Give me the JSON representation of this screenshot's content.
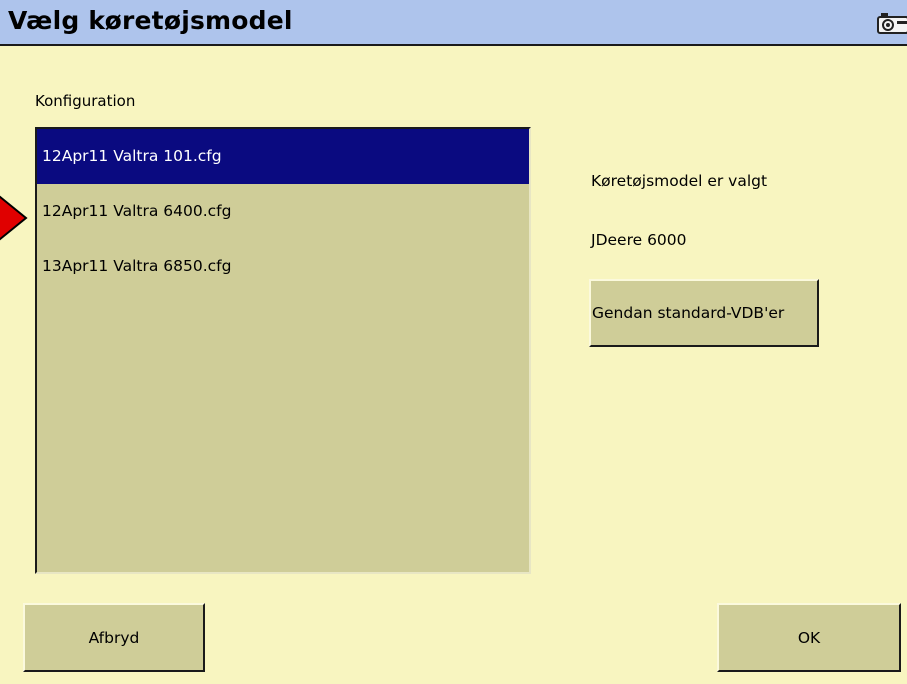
{
  "window": {
    "title": "Vælg køretøjsmodel",
    "camera_icon": "camera-icon"
  },
  "config": {
    "label": "Konfiguration",
    "items": [
      {
        "label": "12Apr11 Valtra 101.cfg",
        "selected": true
      },
      {
        "label": "12Apr11 Valtra 6400.cfg",
        "selected": false
      },
      {
        "label": "13Apr11 Valtra 6850.cfg",
        "selected": false
      }
    ],
    "pointer_icon": "red-arrow-pointer-icon"
  },
  "status": {
    "label": "Køretøjsmodel er valgt",
    "value": "JDeere 6000"
  },
  "buttons": {
    "restore_label": "Gendan standard-VDB'er",
    "cancel_label": "Afbryd",
    "ok_label": "OK"
  },
  "colors": {
    "background": "#f8f5c0",
    "titlebar": "#aec4ec",
    "control": "#cfcd98",
    "selection": "#0a0a80",
    "pointer": "#e00000"
  }
}
